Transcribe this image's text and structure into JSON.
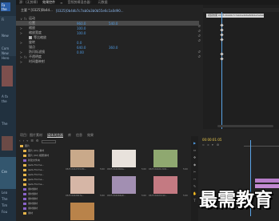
{
  "browser": {
    "logo": "Fa\nthe",
    "side_texts": [
      "Fi",
      "New",
      "Com",
      "New",
      "Hero",
      "A fa",
      "the",
      "The",
      "Cre",
      "Lea",
      "The",
      "Tim",
      "Fou",
      "Lion",
      "Pho"
    ]
  },
  "title_tabs": [
    "源：(无剪辑)",
    "效果控件",
    "≡",
    "音频剪辑混合器：",
    "元数据"
  ],
  "effect_controls": {
    "master": "主要 * [0325]0b4d...",
    "clip_left": "[0325]0b4db7c7ab0a3b0b55e6c1a0d90...",
    "clip_right": "视频效果 0325 0b4db7c7ab0a4b6a8d64a3a0e04ce...",
    "rows": [
      {
        "label": "运动",
        "tri": "∨",
        "fx": "fx",
        "value": ""
      },
      {
        "label": "位置",
        "tri": "",
        "fx": "",
        "value": "960.0",
        "value2": "540.0",
        "selected": true
      },
      {
        "label": "缩放",
        "tri": ">",
        "fx": "",
        "value": "100.0"
      },
      {
        "label": "缩放宽度",
        "tri": ">",
        "fx": "",
        "value": "100.0"
      },
      {
        "label": "等比缩放",
        "tri": "",
        "fx": "",
        "checkbox": true
      },
      {
        "label": "旋转",
        "tri": ">",
        "fx": "",
        "value": "0.0"
      },
      {
        "label": "锚点",
        "tri": "",
        "fx": "",
        "value": "640.0",
        "value2": "360.0"
      },
      {
        "label": "防闪烁滤镜",
        "tri": ">",
        "fx": "",
        "value": "0.00"
      },
      {
        "label": "不透明度",
        "tri": ">",
        "fx": "fx",
        "value": ""
      },
      {
        "label": "时间重映射",
        "tri": ">",
        "fx": "",
        "value": ""
      }
    ],
    "timecode": "00:00:01:05 (*)  00:00:02:00 (*)00:00:03:00 (*)"
  },
  "project": {
    "tabs": [
      "项目：图片素材",
      "媒体浏览器",
      "库",
      "信息",
      "效果"
    ],
    "active_tab": "媒体浏览器",
    "tree_root": "图片",
    "tree": [
      {
        "label": "图片",
        "purple": false
      },
      {
        "label": "图片 (01) 素材",
        "purple": false
      },
      {
        "label": "图片 (02) 相册素材",
        "purple": false
      },
      {
        "label": "新建文件夹",
        "purple": true
      },
      {
        "label": "ljads Forme...",
        "purple": false
      },
      {
        "label": "ljads Forme...",
        "purple": false
      },
      {
        "label": "ljads Forme...",
        "purple": false
      },
      {
        "label": "ljads Forme...",
        "purple": false
      },
      {
        "label": "ljads Forme...",
        "purple": false
      },
      {
        "label": "素材素材",
        "purple": true
      },
      {
        "label": "素材素材",
        "purple": true
      },
      {
        "label": "素材素材",
        "purple": true
      },
      {
        "label": "素材素材",
        "purple": true
      },
      {
        "label": "素材素材",
        "purple": true
      },
      {
        "label": "素材",
        "purple": false
      }
    ],
    "thumbs": [
      {
        "name": "0325 0b4d7b5c8b...",
        "dur": "5:00",
        "color": "#c9a98a"
      },
      {
        "name": "0325 0b4d9b6a...",
        "dur": "5:00",
        "color": "#e8e2dc"
      },
      {
        "name": "0325 0b4d1c9d4...",
        "dur": "5:00",
        "color": "#8fa870"
      },
      {
        "name": "0325 0b4d0b7e...",
        "dur": "5:00",
        "color": "#d6b6a6"
      },
      {
        "name": "0325 0b4db6a0...",
        "dur": "5:00",
        "color": "#a28fb2"
      },
      {
        "name": "0325 0b4d3c4d...",
        "dur": "5:00",
        "color": "#c47a82"
      },
      {
        "name": "",
        "dur": "",
        "color": "#b9834a"
      }
    ]
  },
  "timeline": {
    "timecode": "00:00:01:05",
    "tools": [
      "▶",
      "⇔",
      "✥",
      "◆",
      "✂",
      "⇿",
      "✎",
      "✋",
      "T"
    ]
  },
  "watermark": "最需教育"
}
